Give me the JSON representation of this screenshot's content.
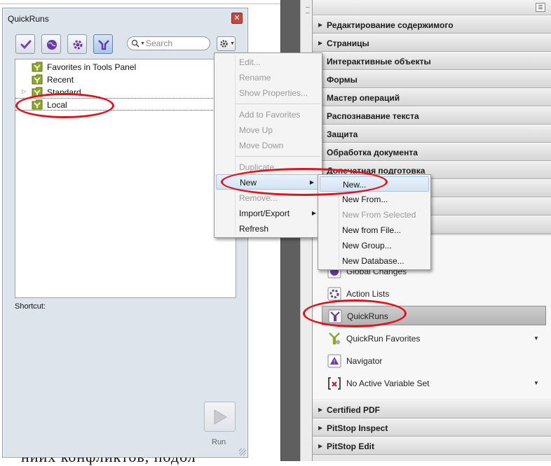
{
  "document": {
    "text": "ниих конфликтов, подол"
  },
  "quickruns": {
    "title": "QuickRuns",
    "close_glyph": "✕",
    "toolbar": [
      {
        "name": "checkmark-icon",
        "color": "#7b3fb4"
      },
      {
        "name": "globe-icon",
        "color": "#6a3aa8"
      },
      {
        "name": "gear-icon",
        "color": "#6a3aa8"
      },
      {
        "name": "quickrun-icon",
        "color": "#ffffff"
      }
    ],
    "search_placeholder": "Search",
    "tree": [
      {
        "label": "Favorites in Tools Panel",
        "expander": ""
      },
      {
        "label": "Recent",
        "expander": ""
      },
      {
        "label": "Standard",
        "expander": "▷"
      },
      {
        "label": "Local",
        "expander": ""
      }
    ],
    "shortcut_label": "Shortcut:",
    "run_label": "Run"
  },
  "context_menu": {
    "items": [
      {
        "label": "Edit...",
        "enabled": false
      },
      {
        "label": "Rename",
        "enabled": false
      },
      {
        "label": "Show Properties...",
        "enabled": false
      },
      {
        "label": "Add to Favorites",
        "enabled": false
      },
      {
        "label": "Move Up",
        "enabled": false
      },
      {
        "label": "Move Down",
        "enabled": false
      },
      {
        "label": "Duplicate",
        "enabled": false
      },
      {
        "label": "New",
        "enabled": true,
        "submenu": true
      },
      {
        "label": "Remove...",
        "enabled": false
      },
      {
        "label": "Import/Export",
        "enabled": true,
        "submenu": true
      },
      {
        "label": "Refresh",
        "enabled": true
      }
    ],
    "submenu_arrow": "▶"
  },
  "new_submenu": {
    "items": [
      {
        "label": "New...",
        "enabled": true
      },
      {
        "label": "New From...",
        "enabled": true
      },
      {
        "label": "New From Selected",
        "enabled": false
      },
      {
        "label": "New from File...",
        "enabled": true
      },
      {
        "label": "New Group...",
        "enabled": true
      },
      {
        "label": "New Database...",
        "enabled": true
      }
    ]
  },
  "tools_panel": {
    "menu_glyph": "☰",
    "sections_top": [
      "Редактирование содержимого",
      "Страницы",
      "Интерактивные объекты",
      "Формы",
      "Мастер операций",
      "Распознавание текста",
      "Защита",
      "Обработка документа",
      "Допечатная подготовка"
    ],
    "tools": [
      {
        "label": "Global Changes",
        "icon": "global-changes-icon",
        "dropdown": false
      },
      {
        "label": "Action Lists",
        "icon": "action-lists-icon",
        "dropdown": false
      },
      {
        "label": "QuickRuns",
        "icon": "quickruns-icon",
        "dropdown": false
      },
      {
        "label": "QuickRun Favorites",
        "icon": "quickrun-favorites-icon",
        "dropdown": true
      },
      {
        "label": "Navigator",
        "icon": "navigator-icon",
        "dropdown": false
      },
      {
        "label": "No Active Variable Set",
        "icon": "variable-set-icon",
        "dropdown": true
      }
    ],
    "sections_bottom": [
      "Certified PDF",
      "PitStop Inspect",
      "PitStop Edit"
    ]
  },
  "colors": {
    "annotation_red": "#e3121b",
    "folder_green": "#8fa82a",
    "accent_purple": "#6a3aa8"
  }
}
